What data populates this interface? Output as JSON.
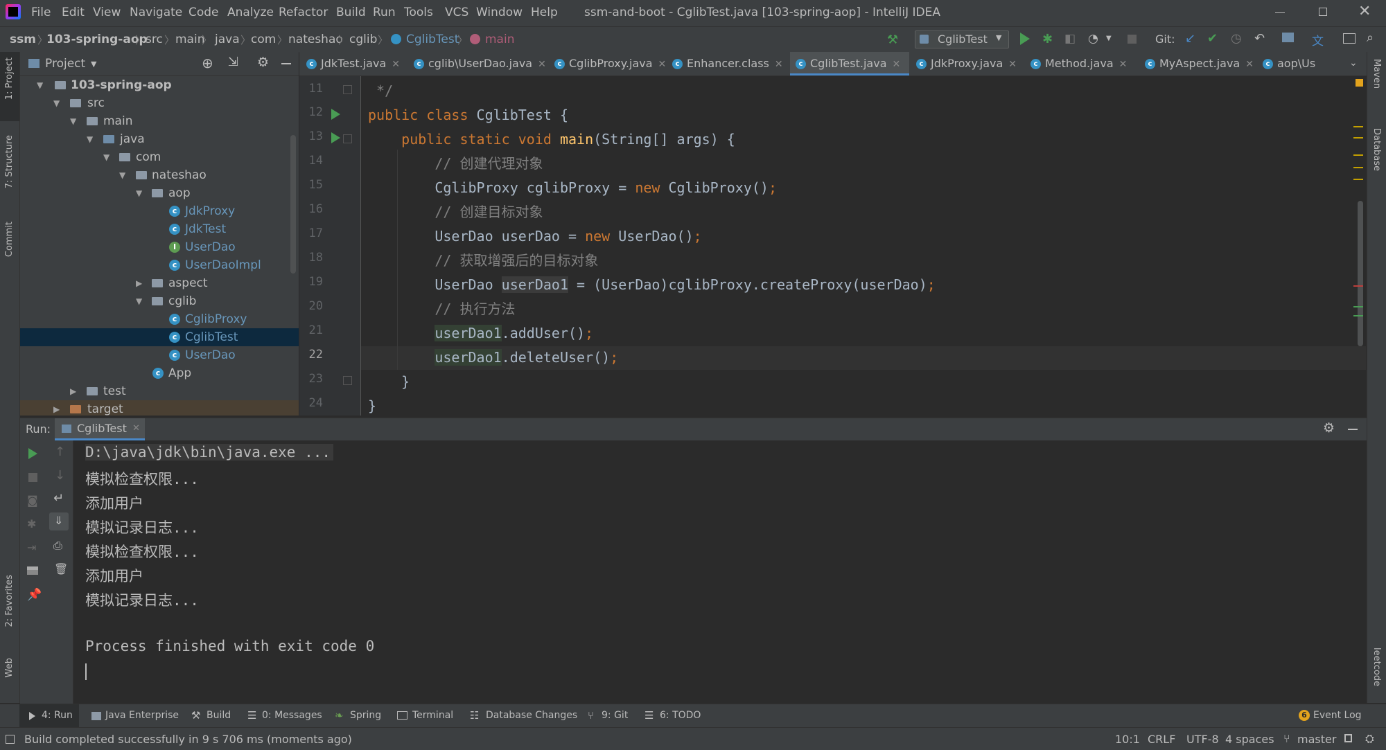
{
  "menubar": {
    "items": [
      "File",
      "Edit",
      "View",
      "Navigate",
      "Code",
      "Analyze",
      "Refactor",
      "Build",
      "Run",
      "Tools",
      "VCS",
      "Window",
      "Help"
    ],
    "window_title": "ssm-and-boot - CglibTest.java [103-spring-aop] - IntelliJ IDEA"
  },
  "navbar": {
    "breadcrumbs": [
      "ssm",
      "103-spring-aop",
      "src",
      "main",
      "java",
      "com",
      "nateshao",
      "cglib",
      "CglibTest",
      "main"
    ],
    "run_config": "CglibTest",
    "git_label": "Git:"
  },
  "left_strip": {
    "project": "1: Project",
    "structure": "7: Structure",
    "commit": "Commit",
    "favorites": "2: Favorites",
    "web": "Web"
  },
  "right_strip": {
    "maven": "Maven",
    "database": "Database",
    "leetcode": "leetcode"
  },
  "project_panel": {
    "title": "Project",
    "tree": [
      {
        "label": "103-spring-aop",
        "type": "module",
        "depth": 0,
        "expanded": true
      },
      {
        "label": "src",
        "type": "folder",
        "depth": 1,
        "expanded": true
      },
      {
        "label": "main",
        "type": "folder",
        "depth": 2,
        "expanded": true
      },
      {
        "label": "java",
        "type": "src",
        "depth": 3,
        "expanded": true
      },
      {
        "label": "com",
        "type": "folder",
        "depth": 4,
        "expanded": true
      },
      {
        "label": "nateshao",
        "type": "folder",
        "depth": 5,
        "expanded": true
      },
      {
        "label": "aop",
        "type": "folder",
        "depth": 6,
        "expanded": true
      },
      {
        "label": "JdkProxy",
        "type": "class",
        "depth": 7
      },
      {
        "label": "JdkTest",
        "type": "class",
        "depth": 7
      },
      {
        "label": "UserDao",
        "type": "interface",
        "depth": 7
      },
      {
        "label": "UserDaoImpl",
        "type": "class",
        "depth": 7
      },
      {
        "label": "aspect",
        "type": "folder",
        "depth": 6,
        "expanded": false
      },
      {
        "label": "cglib",
        "type": "folder",
        "depth": 6,
        "expanded": true
      },
      {
        "label": "CglibProxy",
        "type": "class",
        "depth": 7
      },
      {
        "label": "CglibTest",
        "type": "class",
        "depth": 7,
        "selected": true
      },
      {
        "label": "UserDao",
        "type": "class",
        "depth": 7
      },
      {
        "label": "App",
        "type": "class",
        "depth": 6
      },
      {
        "label": "test",
        "type": "folder",
        "depth": 2,
        "expanded": false
      },
      {
        "label": "target",
        "type": "target",
        "depth": 1,
        "expanded": false
      }
    ]
  },
  "tabs": [
    {
      "label": "JdkTest.java",
      "active": false
    },
    {
      "label": "cglib\\UserDao.java",
      "active": false
    },
    {
      "label": "CglibProxy.java",
      "active": false
    },
    {
      "label": "Enhancer.class",
      "active": false
    },
    {
      "label": "CglibTest.java",
      "active": true
    },
    {
      "label": "JdkProxy.java",
      "active": false
    },
    {
      "label": "Method.java",
      "active": false
    },
    {
      "label": "MyAspect.java",
      "active": false
    },
    {
      "label": "aop\\Us",
      "active": false
    }
  ],
  "editor": {
    "line_numbers": [
      "11",
      "12",
      "13",
      "14",
      "15",
      "16",
      "17",
      "18",
      "19",
      "20",
      "21",
      "22",
      "23",
      "24"
    ],
    "current_line": "22",
    "code": {
      "l11": " */",
      "l12_kw": "public class ",
      "l12_name": "CglibTest {",
      "l13_kw": "    public static void ",
      "l13_fn": "main",
      "l13_rest": "(String[] args) {",
      "l14": "        // 创建代理对象",
      "l15_a": "        CglibProxy cglibProxy = ",
      "l15_kw": "new",
      "l15_b": " CglibProxy()",
      "l15_c": ";",
      "l16": "        // 创建目标对象",
      "l17_a": "        UserDao userDao = ",
      "l17_kw": "new",
      "l17_b": " UserDao()",
      "l17_c": ";",
      "l18": "        // 获取增强后的目标对象",
      "l19_a": "        UserDao ",
      "l19_var": "userDao1",
      "l19_b": " = (UserDao)cglibProxy.createProxy(userDao)",
      "l19_c": ";",
      "l20": "        // 执行方法",
      "l21_pre": "        ",
      "l21_var": "userDao1",
      "l21_b": ".addUser()",
      "l21_c": ";",
      "l22_pre": "        ",
      "l22_var": "userDao1",
      "l22_b": ".deleteUser()",
      "l22_c": ";",
      "l23": "    }",
      "l24": "}"
    }
  },
  "run_panel": {
    "label": "Run:",
    "tab": "CglibTest",
    "output": [
      "D:\\java\\jdk\\bin\\java.exe ...",
      "模拟检查权限...",
      "添加用户",
      "模拟记录日志...",
      "模拟检查权限...",
      "添加用户",
      "模拟记录日志...",
      "",
      "Process finished with exit code 0"
    ]
  },
  "tool_buttons": [
    "4: Run",
    "Java Enterprise",
    "Build",
    "0: Messages",
    "Spring",
    "Terminal",
    "Database Changes",
    "9: Git",
    "6: TODO"
  ],
  "event_log": {
    "badge": "6",
    "label": "Event Log"
  },
  "status_bar": {
    "message": "Build completed successfully in 9 s 706 ms (moments ago)",
    "position": "10:1",
    "line_sep": "CRLF",
    "encoding": "UTF-8",
    "indent": "4 spaces",
    "branch": "master"
  },
  "colors": {
    "background": "#2b2b2b",
    "panel": "#3c3f41",
    "keyword": "#cc7832",
    "comment": "#808080",
    "function": "#ffc66d",
    "selection": "#0d293e",
    "run_green": "#499c54",
    "accent": "#4a88c7"
  }
}
